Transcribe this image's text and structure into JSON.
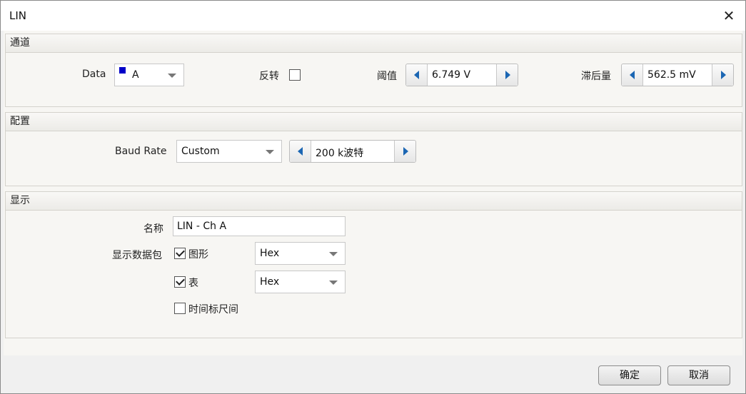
{
  "window": {
    "title": "LIN"
  },
  "channel": {
    "header": "通道",
    "data_label": "Data",
    "data_value": "A",
    "data_color": "#0000c8",
    "invert_label": "反转",
    "invert_checked": false,
    "threshold_label": "阈值",
    "threshold_value": "6.749 V",
    "hysteresis_label": "滞后量",
    "hysteresis_value": "562.5 mV"
  },
  "config": {
    "header": "配置",
    "baud_label": "Baud Rate",
    "baud_mode": "Custom",
    "baud_value": "200 k波特"
  },
  "display": {
    "header": "显示",
    "name_label": "名称",
    "name_value": "LIN - Ch A",
    "packets_label": "显示数据包",
    "graph_label": "图形",
    "graph_checked": true,
    "graph_format": "Hex",
    "table_label": "表",
    "table_checked": true,
    "table_format": "Hex",
    "ruler_label": "时间标尺间",
    "ruler_checked": false
  },
  "footer": {
    "ok_label": "确定",
    "cancel_label": "取消"
  }
}
